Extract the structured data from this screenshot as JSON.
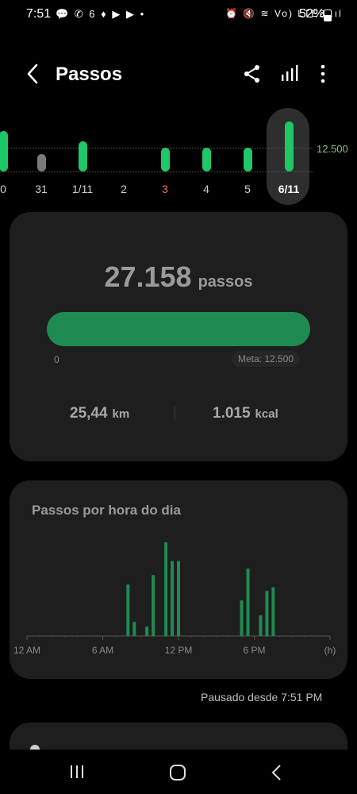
{
  "status_bar": {
    "time": "7:51",
    "notification_icons": "💬 ✆ 6 ♦ ▶ ▶ •",
    "right_icons": "⏰ 🔇 ≋ Vo) LTE2 .ıl",
    "battery": "52%"
  },
  "header": {
    "title": "Passos",
    "back_icon": "chevron-left-icon",
    "share_icon": "share-icon",
    "chart_icon": "bar-chart-icon",
    "menu_icon": "more-vertical-icon"
  },
  "day_strip": {
    "goal_label": "12.500",
    "days": [
      {
        "label": "0",
        "color": "#1ec768",
        "selected": false
      },
      {
        "label": "31",
        "color": "#7a7a7a",
        "selected": false
      },
      {
        "label": "1/11",
        "color": "#1ec768",
        "selected": false
      },
      {
        "label": "2",
        "color": "",
        "selected": false
      },
      {
        "label": "3",
        "color": "#1ec768",
        "selected": false,
        "label_color": "#ff6b5a"
      },
      {
        "label": "4",
        "color": "#1ec768",
        "selected": false
      },
      {
        "label": "5",
        "color": "#1ec768",
        "selected": false
      },
      {
        "label": "6/11",
        "color": "#1ec768",
        "selected": true
      }
    ]
  },
  "summary": {
    "steps": "27.158",
    "steps_unit": "passos",
    "progress_start": "0",
    "goal": "Meta: 12.500",
    "progress_fraction": 1.0,
    "distance_value": "25,44",
    "distance_unit": "km",
    "calories_value": "1.015",
    "calories_unit": "kcal"
  },
  "hourly": {
    "title": "Passos por hora do dia",
    "paused": "Pausado desde 7:51 PM"
  },
  "chart_data": {
    "type": "bar",
    "title": "Passos por hora do dia",
    "x_ticks": [
      "12 AM",
      "6 AM",
      "12 PM",
      "6 PM",
      "(h)"
    ],
    "x_unit": "(h)",
    "x": [
      8.0,
      8.5,
      9.5,
      10.0,
      11.0,
      11.5,
      12.0,
      17.0,
      17.5,
      18.5,
      19.0,
      19.5
    ],
    "values": [
      0.55,
      0.15,
      0.1,
      0.65,
      1.0,
      0.8,
      0.8,
      0.38,
      0.72,
      0.22,
      0.48,
      0.52
    ],
    "y_unit": "relative (no axis labels shown)",
    "bar_color": "#1f8b52",
    "grid": false
  },
  "nav_bar": {
    "recent_icon": "recent-apps-icon",
    "home_icon": "home-icon",
    "back_icon": "back-nav-icon"
  }
}
